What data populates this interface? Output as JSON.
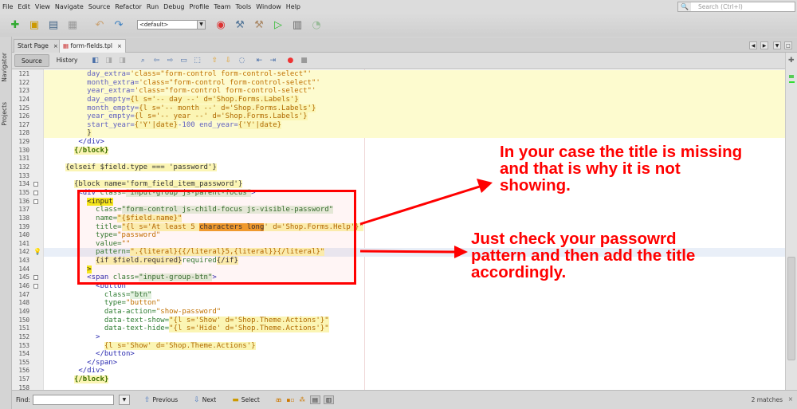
{
  "menu": [
    "File",
    "Edit",
    "View",
    "Navigate",
    "Source",
    "Refactor",
    "Run",
    "Debug",
    "Profile",
    "Team",
    "Tools",
    "Window",
    "Help"
  ],
  "search": {
    "placeholder": "Search (Ctrl+I)"
  },
  "toolbar": {
    "config": "<default>"
  },
  "sidebar": {
    "navigator": "Navigator",
    "projects": "Projects"
  },
  "tabs": [
    {
      "label": "Start Page",
      "close": "×"
    },
    {
      "label": "form-fields.tpl",
      "close": "×"
    }
  ],
  "editor_toolbar": {
    "source": "Source",
    "history": "History"
  },
  "code_lines": [
    {
      "n": "121",
      "bg": "y",
      "seg": [
        [
          "          day_extra=",
          "v"
        ],
        [
          "'class=\"form-control form-control-select\"'",
          "s"
        ]
      ]
    },
    {
      "n": "122",
      "bg": "y",
      "seg": [
        [
          "          month_extra=",
          "v"
        ],
        [
          "'class=\"form-control form-control-select\"'",
          "s"
        ]
      ]
    },
    {
      "n": "123",
      "bg": "y",
      "seg": [
        [
          "          year_extra=",
          "v"
        ],
        [
          "'class=\"form-control form-control-select\"'",
          "s"
        ]
      ]
    },
    {
      "n": "124",
      "bg": "y",
      "seg": [
        [
          "          day_empty=",
          "v"
        ],
        [
          "{l s='-- day --' d='Shop.Forms.Labels'}",
          "ssv"
        ]
      ]
    },
    {
      "n": "125",
      "bg": "y",
      "seg": [
        [
          "          month_empty=",
          "v"
        ],
        [
          "{l s='-- month --' d='Shop.Forms.Labels'}",
          "ssv"
        ]
      ]
    },
    {
      "n": "126",
      "bg": "y",
      "seg": [
        [
          "          year_empty=",
          "v"
        ],
        [
          "{l s='-- year --' d='Shop.Forms.Labels'}",
          "ssv"
        ]
      ]
    },
    {
      "n": "127",
      "bg": "y",
      "seg": [
        [
          "          start_year=",
          "v"
        ],
        [
          "{'Y'|date}",
          "ssv"
        ],
        [
          "-100 end_year=",
          "v"
        ],
        [
          "{'Y'|date}",
          "ssv"
        ]
      ]
    },
    {
      "n": "128",
      "bg": "y",
      "seg": [
        [
          "          ",
          "p"
        ],
        [
          "}",
          "sy"
        ]
      ]
    },
    {
      "n": "129",
      "seg": [
        [
          "        </div>",
          "t"
        ]
      ]
    },
    {
      "n": "130",
      "seg": [
        [
          "       ",
          "p"
        ],
        [
          "{/block}",
          "syk"
        ]
      ]
    },
    {
      "n": "131",
      "seg": [
        [
          "",
          "p"
        ]
      ]
    },
    {
      "n": "132",
      "seg": [
        [
          "     ",
          "p"
        ],
        [
          "{elseif $field.type === 'password'}",
          "sy"
        ]
      ]
    },
    {
      "n": "133",
      "seg": [
        [
          "",
          "p"
        ]
      ]
    },
    {
      "n": "134",
      "fold": true,
      "seg": [
        [
          "       ",
          "p"
        ],
        [
          "{block name='form_field_item_password'}",
          "sy"
        ]
      ]
    },
    {
      "n": "135",
      "fold": true,
      "seg": [
        [
          "        <div ",
          "t"
        ],
        [
          "class=",
          "a"
        ],
        [
          "'input-group js-parent-focus'",
          "gs"
        ],
        [
          ">",
          "t"
        ]
      ]
    },
    {
      "n": "136",
      "fold": true,
      "seg": [
        [
          "          ",
          "p"
        ],
        [
          "<input",
          "inp"
        ]
      ]
    },
    {
      "n": "137",
      "seg": [
        [
          "            class=",
          "a"
        ],
        [
          "\"form-control js-child-focus js-visible-password\"",
          "gs"
        ]
      ]
    },
    {
      "n": "138",
      "seg": [
        [
          "            name=",
          "a"
        ],
        [
          "\"{$field.name}\"",
          "ssv"
        ]
      ]
    },
    {
      "n": "139",
      "seg": [
        [
          "            title=",
          "a"
        ],
        [
          "\"{l s='At least 5 ",
          "ssv"
        ],
        [
          "characters long",
          "mark"
        ],
        [
          "' d='Shop.Forms.Help'}\"",
          "ssv"
        ]
      ]
    },
    {
      "n": "140",
      "seg": [
        [
          "            type=",
          "a"
        ],
        [
          "\"password\"",
          "s"
        ]
      ]
    },
    {
      "n": "141",
      "seg": [
        [
          "            value=",
          "a"
        ],
        [
          "\"\"",
          "s"
        ]
      ]
    },
    {
      "n": "142",
      "bg": "cur",
      "bulb": true,
      "seg": [
        [
          "            pattern=",
          "a"
        ],
        [
          "\".{literal}{{/literal}5,{literal}}{/literal}\"",
          "ssv"
        ]
      ]
    },
    {
      "n": "143",
      "seg": [
        [
          "            ",
          "p"
        ],
        [
          "{if $field.required}",
          "sy"
        ],
        [
          "required",
          "a"
        ],
        [
          "{/if}",
          "sy"
        ]
      ]
    },
    {
      "n": "144",
      "seg": [
        [
          "          ",
          "p"
        ],
        [
          ">",
          "inp"
        ]
      ]
    },
    {
      "n": "145",
      "fold": true,
      "seg": [
        [
          "          <span ",
          "t"
        ],
        [
          "class=",
          "a"
        ],
        [
          "\"input-group-btn\"",
          "gs"
        ],
        [
          ">",
          "t"
        ]
      ]
    },
    {
      "n": "146",
      "fold": true,
      "seg": [
        [
          "            <button",
          "t"
        ]
      ]
    },
    {
      "n": "147",
      "seg": [
        [
          "              class=",
          "a"
        ],
        [
          "\"btn\"",
          "gs"
        ]
      ]
    },
    {
      "n": "148",
      "seg": [
        [
          "              type=",
          "a"
        ],
        [
          "\"button\"",
          "s"
        ]
      ]
    },
    {
      "n": "149",
      "seg": [
        [
          "              data-action=",
          "a"
        ],
        [
          "\"show-password\"",
          "s"
        ]
      ]
    },
    {
      "n": "150",
      "seg": [
        [
          "              data-text-show=",
          "a"
        ],
        [
          "\"{l s='Show' d='Shop.Theme.Actions'}\"",
          "ssv"
        ]
      ]
    },
    {
      "n": "151",
      "seg": [
        [
          "              data-text-hide=",
          "a"
        ],
        [
          "\"{l s='Hide' d='Shop.Theme.Actions'}\"",
          "ssv"
        ]
      ]
    },
    {
      "n": "152",
      "seg": [
        [
          "            >",
          "t"
        ]
      ]
    },
    {
      "n": "153",
      "seg": [
        [
          "              ",
          "p"
        ],
        [
          "{l s='Show' d='Shop.Theme.Actions'}",
          "ssv"
        ]
      ]
    },
    {
      "n": "154",
      "seg": [
        [
          "            </button>",
          "t"
        ]
      ]
    },
    {
      "n": "155",
      "seg": [
        [
          "          </span>",
          "t"
        ]
      ]
    },
    {
      "n": "156",
      "seg": [
        [
          "        </div>",
          "t"
        ]
      ]
    },
    {
      "n": "157",
      "seg": [
        [
          "       ",
          "p"
        ],
        [
          "{/block}",
          "syk"
        ]
      ]
    },
    {
      "n": "158",
      "seg": [
        [
          "",
          "p"
        ]
      ]
    }
  ],
  "annotations": {
    "note1": "In your case the title is missing and that is why it is not showing.",
    "note2": "Just check your passowrd pattern and then add the title accordingly.",
    "color": "#ff0000"
  },
  "findbar": {
    "label": "Find:",
    "value": "",
    "previous": "Previous",
    "next": "Next",
    "select": "Select",
    "matches": "2 matches",
    "close": "×"
  }
}
